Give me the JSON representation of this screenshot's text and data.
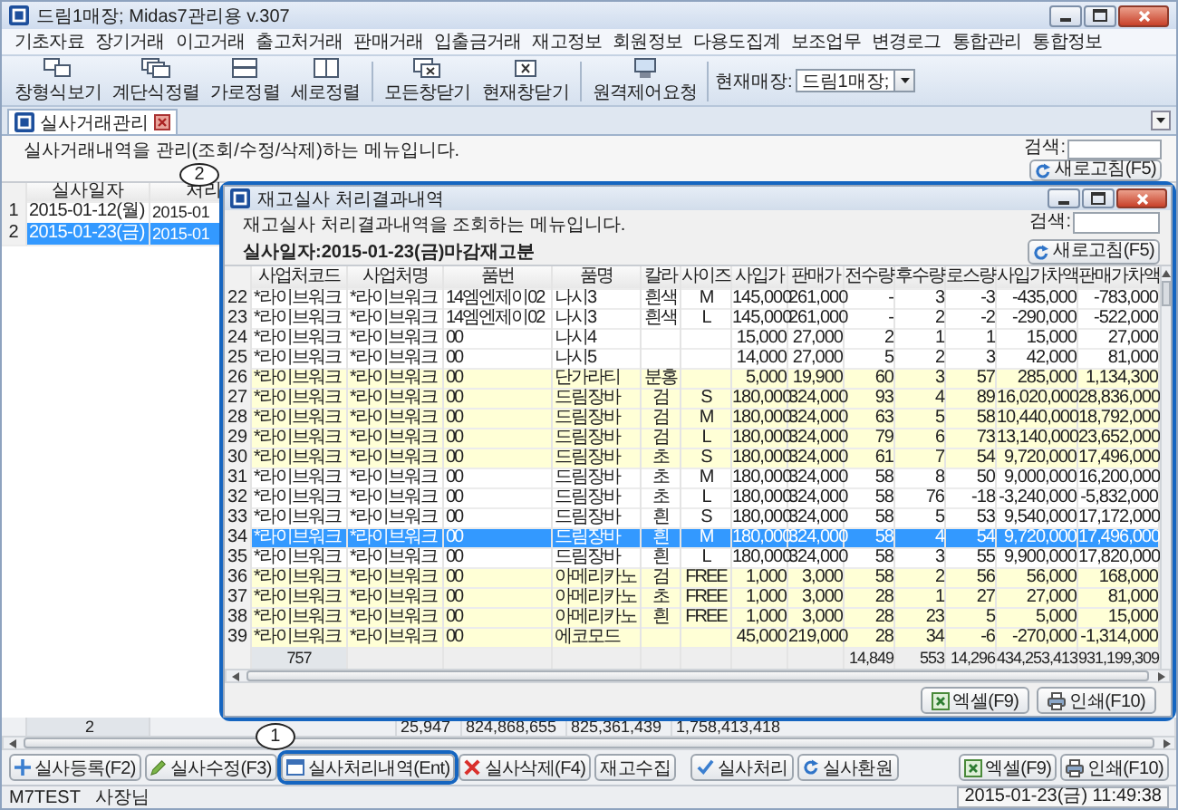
{
  "window": {
    "title": "드림1매장; Midas7관리용 v.307"
  },
  "menu": [
    "기초자료",
    "장기거래",
    "이고거래",
    "출고처거래",
    "판매거래",
    "입출금거래",
    "재고정보",
    "회원정보",
    "다용도집계",
    "보조업무",
    "변경로그",
    "통합관리",
    "통합정보"
  ],
  "toolbar": {
    "groups": [
      [
        {
          "label": "창형식보기"
        },
        {
          "label": "계단식정렬"
        },
        {
          "label": "가로정렬"
        },
        {
          "label": "세로정렬"
        }
      ],
      [
        {
          "label": "모든창닫기"
        },
        {
          "label": "현재창닫기"
        }
      ],
      [
        {
          "label": "원격제어요청"
        }
      ]
    ],
    "store_selector": {
      "label": "현재매장:",
      "value": "드림1매장;"
    }
  },
  "tabs": [
    {
      "label": "실사거래관리",
      "selected": true
    }
  ],
  "description": "실사거래내역을 관리(조회/수정/삭제)하는 메뉴입니다.",
  "search": {
    "label": "검색:"
  },
  "refresh_button": "새로고침(F5)",
  "grid": {
    "columns": [
      "실사일자",
      "처리"
    ],
    "rows": [
      {
        "number": "1",
        "cells": [
          "2015-01-12(월)",
          "2015-01"
        ],
        "selected": false
      },
      {
        "number": "2",
        "cells": [
          "2015-01-23(금)",
          "2015-01"
        ],
        "selected": true
      }
    ],
    "footer": {
      "count": "2",
      "totals": [
        "25,947",
        "824,868,655",
        "825,361,439",
        "1,758,413,418"
      ]
    }
  },
  "dialog": {
    "title": "재고실사 처리결과내역",
    "callout": "2",
    "highlighted": true,
    "description": "재고실사 처리결과내역을 조회하는 메뉴입니다.",
    "date_label": "실사일자:2015-01-23(금)마감재고분",
    "search": {
      "label": "검색:"
    },
    "refresh_button": "새로고침(F5)",
    "table": {
      "columns": [
        "사업처코드",
        "사업처명",
        "품번",
        "품명",
        "칼라",
        "사이즈",
        "사입가",
        "판매가",
        "전수량",
        "후수량",
        "로스량",
        "사입가차액",
        "판매가차액"
      ],
      "rows": [
        {
          "number": "22",
          "code": "*라이브워크",
          "name": "*라이브워크",
          "item_no": "14엠엔제이02",
          "item_name": "나시3",
          "item_color": "흰색",
          "size": "M",
          "cost": "145,000",
          "price": "261,000",
          "before_qty": "-",
          "after_qty": "3",
          "loss": "-3",
          "cost_diff": "-435,000",
          "price_diff": "-783,000",
          "highlighted": false,
          "selected": false
        },
        {
          "number": "23",
          "code": "*라이브워크",
          "name": "*라이브워크",
          "item_no": "14엠엔제이02",
          "item_name": "나시3",
          "item_color": "흰색",
          "size": "L",
          "cost": "145,000",
          "price": "261,000",
          "before_qty": "-",
          "after_qty": "2",
          "loss": "-2",
          "cost_diff": "-290,000",
          "price_diff": "-522,000",
          "highlighted": false,
          "selected": false
        },
        {
          "number": "24",
          "code": "*라이브워크",
          "name": "*라이브워크",
          "item_no": "00",
          "item_name": "나시4",
          "cost": "15,000",
          "price": "27,000",
          "before_qty": "2",
          "after_qty": "1",
          "loss": "1",
          "cost_diff": "15,000",
          "price_diff": "27,000",
          "highlighted": false,
          "selected": false
        },
        {
          "number": "25",
          "code": "*라이브워크",
          "name": "*라이브워크",
          "item_no": "00",
          "item_name": "나시5",
          "cost": "14,000",
          "price": "27,000",
          "before_qty": "5",
          "after_qty": "2",
          "loss": "3",
          "cost_diff": "42,000",
          "price_diff": "81,000",
          "highlighted": false,
          "selected": false
        },
        {
          "number": "26",
          "code": "*라이브워크",
          "name": "*라이브워크",
          "item_no": "00",
          "item_name": "단가라티",
          "item_color": "분홍",
          "cost": "5,000",
          "price": "19,900",
          "before_qty": "60",
          "after_qty": "3",
          "loss": "57",
          "cost_diff": "285,000",
          "price_diff": "1,134,300",
          "highlighted": true,
          "selected": false
        },
        {
          "number": "27",
          "code": "*라이브워크",
          "name": "*라이브워크",
          "item_no": "00",
          "item_name": "드림장바",
          "item_color": "검",
          "size": "S",
          "cost": "180,000",
          "price": "324,000",
          "before_qty": "93",
          "after_qty": "4",
          "loss": "89",
          "cost_diff": "16,020,000",
          "price_diff": "28,836,000",
          "highlighted": true,
          "selected": false
        },
        {
          "number": "28",
          "code": "*라이브워크",
          "name": "*라이브워크",
          "item_no": "00",
          "item_name": "드림장바",
          "item_color": "검",
          "size": "M",
          "cost": "180,000",
          "price": "324,000",
          "before_qty": "63",
          "after_qty": "5",
          "loss": "58",
          "cost_diff": "10,440,000",
          "price_diff": "18,792,000",
          "highlighted": true,
          "selected": false
        },
        {
          "number": "29",
          "code": "*라이브워크",
          "name": "*라이브워크",
          "item_no": "00",
          "item_name": "드림장바",
          "item_color": "검",
          "size": "L",
          "cost": "180,000",
          "price": "324,000",
          "before_qty": "79",
          "after_qty": "6",
          "loss": "73",
          "cost_diff": "13,140,000",
          "price_diff": "23,652,000",
          "highlighted": true,
          "selected": false
        },
        {
          "number": "30",
          "code": "*라이브워크",
          "name": "*라이브워크",
          "item_no": "00",
          "item_name": "드림장바",
          "item_color": "초",
          "size": "S",
          "cost": "180,000",
          "price": "324,000",
          "before_qty": "61",
          "after_qty": "7",
          "loss": "54",
          "cost_diff": "9,720,000",
          "price_diff": "17,496,000",
          "highlighted": true,
          "selected": false
        },
        {
          "number": "31",
          "code": "*라이브워크",
          "name": "*라이브워크",
          "item_no": "00",
          "item_name": "드림장바",
          "item_color": "초",
          "size": "M",
          "cost": "180,000",
          "price": "324,000",
          "before_qty": "58",
          "after_qty": "8",
          "loss": "50",
          "cost_diff": "9,000,000",
          "price_diff": "16,200,000",
          "highlighted": false,
          "selected": false
        },
        {
          "number": "32",
          "code": "*라이브워크",
          "name": "*라이브워크",
          "item_no": "00",
          "item_name": "드림장바",
          "item_color": "초",
          "size": "L",
          "cost": "180,000",
          "price": "324,000",
          "before_qty": "58",
          "after_qty": "76",
          "loss": "-18",
          "cost_diff": "-3,240,000",
          "price_diff": "-5,832,000",
          "highlighted": false,
          "selected": false
        },
        {
          "number": "33",
          "code": "*라이브워크",
          "name": "*라이브워크",
          "item_no": "00",
          "item_name": "드림장바",
          "item_color": "흰",
          "size": "S",
          "cost": "180,000",
          "price": "324,000",
          "before_qty": "58",
          "after_qty": "5",
          "loss": "53",
          "cost_diff": "9,540,000",
          "price_diff": "17,172,000",
          "highlighted": false,
          "selected": false
        },
        {
          "number": "34",
          "code": "*라이브워크",
          "name": "*라이브워크",
          "item_no": "00",
          "item_name": "드림장바",
          "item_color": "흰",
          "size": "M",
          "cost": "180,000",
          "price": "324,000",
          "before_qty": "58",
          "after_qty": "4",
          "loss": "54",
          "cost_diff": "9,720,000",
          "price_diff": "17,496,000",
          "highlighted": false,
          "selected": true
        },
        {
          "number": "35",
          "code": "*라이브워크",
          "name": "*라이브워크",
          "item_no": "00",
          "item_name": "드림장바",
          "item_color": "흰",
          "size": "L",
          "cost": "180,000",
          "price": "324,000",
          "before_qty": "58",
          "after_qty": "3",
          "loss": "55",
          "cost_diff": "9,900,000",
          "price_diff": "17,820,000",
          "highlighted": false,
          "selected": false
        },
        {
          "number": "36",
          "code": "*라이브워크",
          "name": "*라이브워크",
          "item_no": "00",
          "item_name": "아메리카노",
          "item_color": "검",
          "size": "FREE",
          "cost": "1,000",
          "price": "3,000",
          "before_qty": "58",
          "after_qty": "2",
          "loss": "56",
          "cost_diff": "56,000",
          "price_diff": "168,000",
          "highlighted": true,
          "selected": false
        },
        {
          "number": "37",
          "code": "*라이브워크",
          "name": "*라이브워크",
          "item_no": "00",
          "item_name": "아메리카노",
          "item_color": "초",
          "size": "FREE",
          "cost": "1,000",
          "price": "3,000",
          "before_qty": "28",
          "after_qty": "1",
          "loss": "27",
          "cost_diff": "27,000",
          "price_diff": "81,000",
          "highlighted": true,
          "selected": false
        },
        {
          "number": "38",
          "code": "*라이브워크",
          "name": "*라이브워크",
          "item_no": "00",
          "item_name": "아메리카노",
          "item_color": "흰",
          "size": "FREE",
          "cost": "1,000",
          "price": "3,000",
          "before_qty": "28",
          "after_qty": "23",
          "loss": "5",
          "cost_diff": "5,000",
          "price_diff": "15,000",
          "highlighted": true,
          "selected": false
        },
        {
          "number": "39",
          "code": "*라이브워크",
          "name": "*라이브워크",
          "item_no": "00",
          "item_name": "에코모드",
          "cost": "45,000",
          "price": "219,000",
          "before_qty": "28",
          "after_qty": "34",
          "loss": "-6",
          "cost_diff": "-270,000",
          "price_diff": "-1,314,000",
          "highlighted": true,
          "selected": false
        }
      ],
      "footer": {
        "count": "757",
        "totals": [
          "14,849",
          "553",
          "14,296",
          "434,253,413",
          "931,199,309"
        ]
      }
    },
    "buttons": [
      {
        "label": "엑셀(F9)"
      },
      {
        "label": "인쇄(F10)"
      }
    ]
  },
  "action_buttons": {
    "left": [
      {
        "label": "실사등록(F2)",
        "highlighted": false
      },
      {
        "label": "실사수정(F3)",
        "highlighted": false
      },
      {
        "label": "실사처리내역(Ent)",
        "highlighted": true,
        "callout": "1"
      },
      {
        "label": "실사삭제(F4)",
        "highlighted": false
      },
      {
        "label": "재고수집",
        "highlighted": false
      }
    ],
    "middle": [
      {
        "label": "실사처리",
        "highlighted": false
      },
      {
        "label": "실사환원",
        "highlighted": false
      }
    ],
    "right": [
      {
        "label": "엑셀(F9)",
        "highlighted": false
      },
      {
        "label": "인쇄(F10)",
        "highlighted": false
      }
    ]
  },
  "status_bar": {
    "user": "M7TEST",
    "role": "사장님",
    "datetime": "2015-01-23(금) 11:49:38"
  }
}
